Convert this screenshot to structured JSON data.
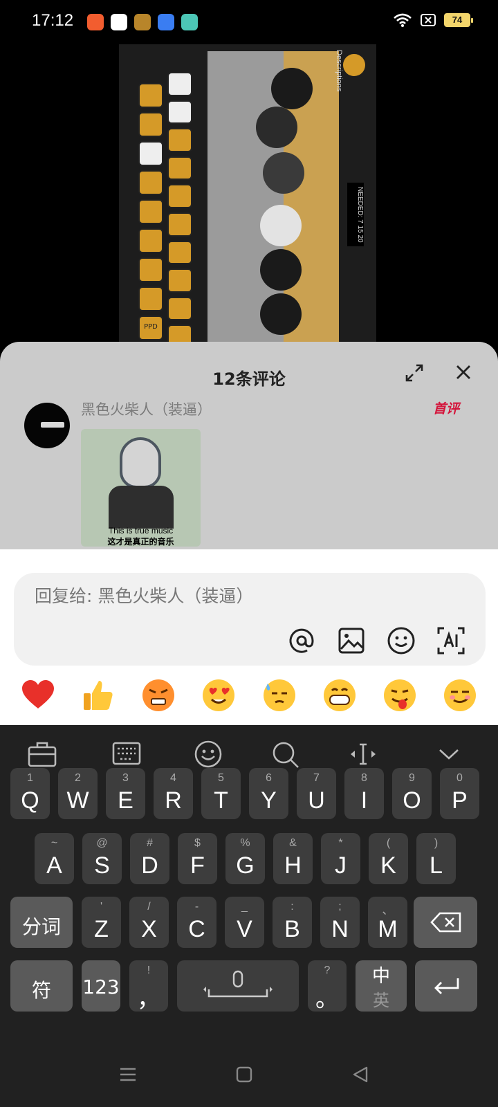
{
  "status": {
    "time": "17:12",
    "battery": "74"
  },
  "video": {
    "descriptions_label": "Descriptions",
    "needed_label": "NEEDED:",
    "needed_values": "7 15 20",
    "ppd_label": "PPD"
  },
  "comments": {
    "title": "12条评论",
    "first_comment": {
      "username": "黑色火柴人（装逼）",
      "badge": "首评",
      "meme_caption_en": "This is true music",
      "meme_caption_zh": "这才是真正的音乐"
    }
  },
  "composer": {
    "placeholder": "回复给: 黑色火柴人（装逼）",
    "tools": [
      "at-icon",
      "image-icon",
      "emoji-icon",
      "ai-icon"
    ],
    "emojis": [
      "heart",
      "thumbs-up",
      "angry",
      "heart-eyes",
      "sweat",
      "grin",
      "tongue-out",
      "smirk"
    ]
  },
  "keyboard": {
    "toolbar": [
      "briefcase-icon",
      "keyboard-icon",
      "emoji-icon",
      "search-icon",
      "cursor-icon",
      "collapse-icon"
    ],
    "row1": [
      {
        "main": "Q",
        "sub": "1"
      },
      {
        "main": "W",
        "sub": "2"
      },
      {
        "main": "E",
        "sub": "3"
      },
      {
        "main": "R",
        "sub": "4"
      },
      {
        "main": "T",
        "sub": "5"
      },
      {
        "main": "Y",
        "sub": "6"
      },
      {
        "main": "U",
        "sub": "7"
      },
      {
        "main": "I",
        "sub": "8"
      },
      {
        "main": "O",
        "sub": "9"
      },
      {
        "main": "P",
        "sub": "0"
      }
    ],
    "row2": [
      {
        "main": "A",
        "sub": "~"
      },
      {
        "main": "S",
        "sub": "@"
      },
      {
        "main": "D",
        "sub": "#"
      },
      {
        "main": "F",
        "sub": "$"
      },
      {
        "main": "G",
        "sub": "%"
      },
      {
        "main": "H",
        "sub": "&"
      },
      {
        "main": "J",
        "sub": "*"
      },
      {
        "main": "K",
        "sub": "("
      },
      {
        "main": "L",
        "sub": ")"
      }
    ],
    "row3": [
      {
        "main": "Z",
        "sub": "'"
      },
      {
        "main": "X",
        "sub": "/"
      },
      {
        "main": "C",
        "sub": "-"
      },
      {
        "main": "V",
        "sub": "_"
      },
      {
        "main": "B",
        "sub": ":"
      },
      {
        "main": "N",
        "sub": ";"
      },
      {
        "main": "M",
        "sub": "、"
      }
    ],
    "segment_label": "分词",
    "symbol_label": "符",
    "num_label": "123",
    "comma_main": "，",
    "comma_sub": "!",
    "period_main": "。",
    "period_sub": "?",
    "lang_top": "中",
    "lang_bottom": "英"
  }
}
